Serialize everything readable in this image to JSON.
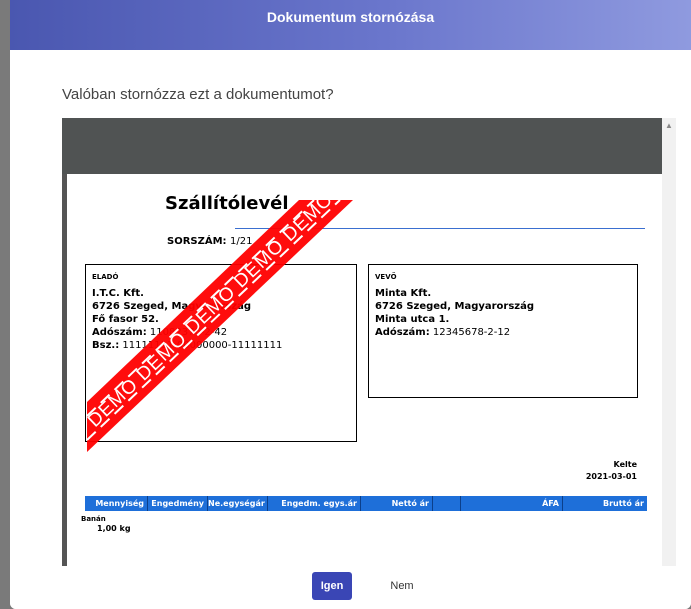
{
  "dialog": {
    "title": "Dokumentum stornózása",
    "question": "Valóban stornózza ezt a dokumentumot?",
    "confirm_label": "Igen",
    "cancel_label": "Nem"
  },
  "document": {
    "title": "Szállítólevél",
    "sorszam_label": "SORSZÁM:",
    "sorszam_value": "1/21",
    "watermark": "DEMO DEMO DEMO DEMO DEMO DE",
    "seller": {
      "header": "ELADÓ",
      "name": "I.T.C. Kft.",
      "city": "6726 Szeged, Magyarország",
      "street": "Fő fasor 52.",
      "tax_label": "Adószám:",
      "tax_value": "11082376-2-42",
      "bank_label": "Bsz.:",
      "bank_value": "11111111-00000000-11111111"
    },
    "buyer": {
      "header": "VEVŐ",
      "name": "Minta Kft.",
      "city": "6726 Szeged, Magyarország",
      "street": "Minta utca 1.",
      "tax_label": "Adószám:",
      "tax_value": "12345678-2-12"
    },
    "kelte_label": "Kelte",
    "kelte_value": "2021-03-01",
    "table": {
      "columns": [
        "Mennyiség",
        "Engedmény",
        "Ne.egységár",
        "Engedm. egys.ár",
        "Nettó ár",
        "",
        "ÁFA",
        "Bruttó ár"
      ]
    },
    "items": [
      {
        "name": "Banán",
        "qty": "1,00 kg"
      }
    ]
  },
  "colors": {
    "header_start": "#4a57b0",
    "header_end": "#8f9adf",
    "confirm_button": "#3a46b5",
    "table_header": "#1e6fd9",
    "watermark": "#ff0000"
  }
}
